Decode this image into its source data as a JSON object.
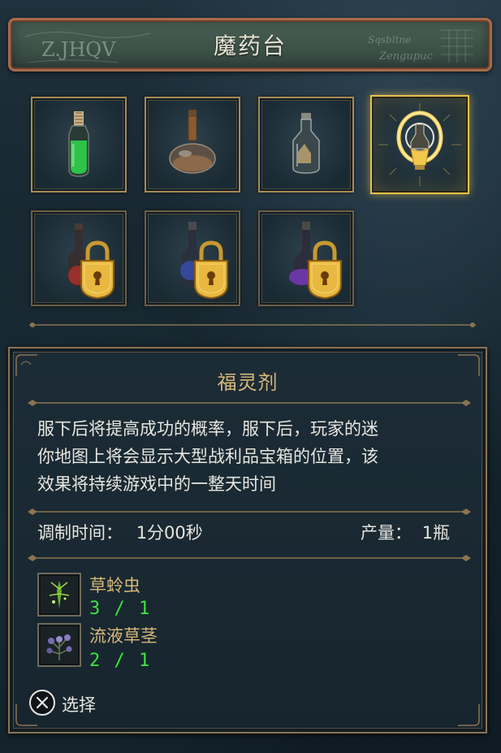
{
  "header": {
    "title": "魔药台",
    "scribble_left": "Z.JHQV",
    "scribble_right": "Zengupuc"
  },
  "potions": [
    {
      "id": "green-potion",
      "locked": false,
      "selected": false,
      "liquid_color": "#2fc24a"
    },
    {
      "id": "brown-round-potion",
      "locked": false,
      "selected": false,
      "liquid_color": "#8a6a4a"
    },
    {
      "id": "clear-potion",
      "locked": false,
      "selected": false,
      "liquid_color": "#b8b0a0"
    },
    {
      "id": "golden-potion",
      "locked": false,
      "selected": true,
      "liquid_color": "#f2c94c"
    },
    {
      "id": "red-potion",
      "locked": true,
      "selected": false,
      "liquid_color": "#b8302a"
    },
    {
      "id": "blue-potion",
      "locked": true,
      "selected": false,
      "liquid_color": "#3a4fb8"
    },
    {
      "id": "purple-potion",
      "locked": true,
      "selected": false,
      "liquid_color": "#7a3ac0"
    }
  ],
  "detail": {
    "name": "福灵剂",
    "description": [
      "服下后将提高成功的概率，服下后，玩家的迷",
      "你地图上将会显示大型战利品宝箱的位置，该",
      "效果将持续游戏中的一整天时间"
    ],
    "brew_time_label": "调制时间：",
    "brew_time_value": "1分00秒",
    "yield_label": "产量：",
    "yield_value": "1瓶",
    "ingredients": [
      {
        "name": "草蛉虫",
        "count": "3 / 1",
        "icon": "lacewing-fly-icon"
      },
      {
        "name": "流液草茎",
        "count": "2 / 1",
        "icon": "fluxweed-stem-icon"
      }
    ]
  },
  "footer": {
    "select_label": "选择",
    "select_icon": "cross-button-icon"
  },
  "colors": {
    "gold": "#d8b87a",
    "count_green": "#3ee33e",
    "frame_gold": "#a98a55"
  }
}
